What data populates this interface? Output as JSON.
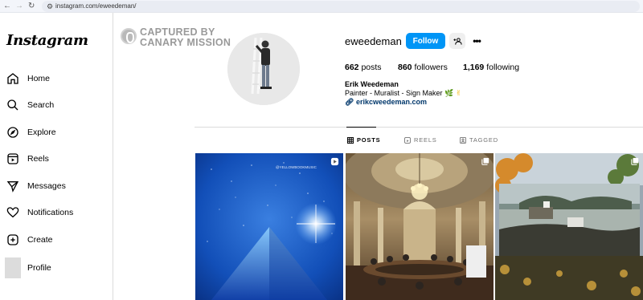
{
  "browser": {
    "url": "instagram.com/eweedeman/"
  },
  "sidebar": {
    "logo": "Instagram",
    "items": [
      {
        "label": "Home",
        "icon": "home-icon"
      },
      {
        "label": "Search",
        "icon": "search-icon"
      },
      {
        "label": "Explore",
        "icon": "compass-icon"
      },
      {
        "label": "Reels",
        "icon": "reels-icon"
      },
      {
        "label": "Messages",
        "icon": "send-icon"
      },
      {
        "label": "Notifications",
        "icon": "heart-icon"
      },
      {
        "label": "Create",
        "icon": "plus-square-icon"
      },
      {
        "label": "Profile",
        "icon": "avatar"
      }
    ]
  },
  "watermark": {
    "line1": "CAPTURED BY",
    "line2": "CANARY MISSION"
  },
  "profile": {
    "username": "eweedeman",
    "follow_label": "Follow",
    "more": "•••",
    "posts_count": "662",
    "posts_label": "posts",
    "followers_count": "860",
    "followers_label": "followers",
    "following_count": "1,169",
    "following_label": "following",
    "full_name": "Erik Weedeman",
    "bio": "Painter - Muralist - Sign Maker",
    "bio_emoji_1": "🌿",
    "bio_emoji_2": "✌",
    "link": "erikcweedeman.com"
  },
  "tabs": [
    {
      "label": "POSTS",
      "active": true
    },
    {
      "label": "REELS",
      "active": false
    },
    {
      "label": "TAGGED",
      "active": false
    }
  ],
  "posts": [
    {
      "kind": "reel",
      "overlay_text": "@YELLOWBOOKMUSIC"
    },
    {
      "kind": "carousel"
    },
    {
      "kind": "carousel"
    }
  ],
  "colors": {
    "follow_button": "#0095f6",
    "link": "#00376b"
  }
}
